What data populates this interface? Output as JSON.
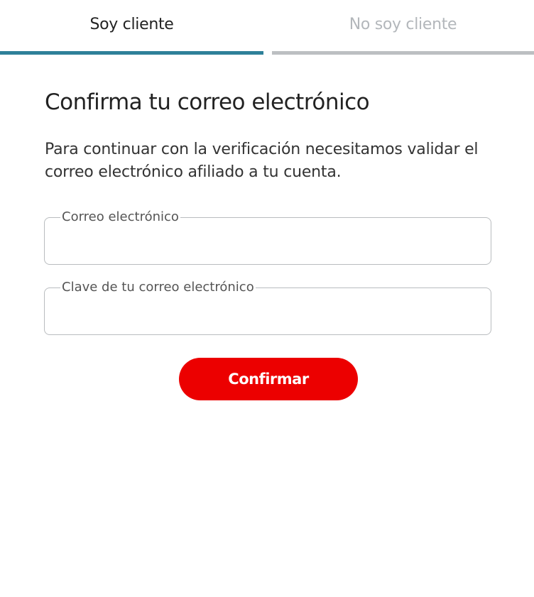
{
  "tabs": {
    "active": {
      "label": "Soy cliente"
    },
    "inactive": {
      "label": "No soy cliente"
    }
  },
  "colors": {
    "active_underline": "#2e8099",
    "inactive_underline": "#bcbfc2",
    "button_bg": "#ec0000"
  },
  "form": {
    "title": "Confirma tu correo electrónico",
    "description": "Para continuar con la verificación necesitamos validar el correo electrónico afiliado a tu cuenta.",
    "email_label": "Correo electrónico",
    "email_value": "",
    "password_label": "Clave de tu correo electrónico",
    "password_value": "",
    "confirm_label": "Confirmar"
  }
}
